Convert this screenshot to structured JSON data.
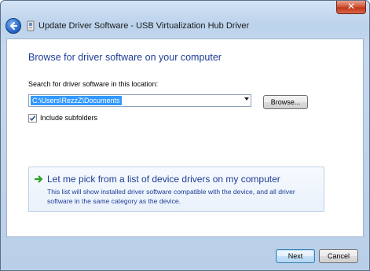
{
  "window": {
    "title": "Update Driver Software - USB Virtualization Hub Driver",
    "close_label": "✕"
  },
  "page": {
    "heading": "Browse for driver software on your computer",
    "search_label": "Search for driver software in this location:",
    "path_value": "C:\\Users\\RezzZ\\Documents",
    "browse_label": "Browse...",
    "include_subfolders_label": "Include subfolders",
    "include_subfolders_checked": true
  },
  "option": {
    "title": "Let me pick from a list of device drivers on my computer",
    "description": "This list will show installed driver software compatible with the device, and all driver software in the same category as the device."
  },
  "buttons": {
    "next_label": "Next",
    "cancel_label": "Cancel"
  },
  "colors": {
    "accent_text": "#1e3c96",
    "selection": "#3399ff",
    "close_red": "#c0391b",
    "arrow_green": "#2aa12a"
  },
  "icons": {
    "back": "back-arrow-icon",
    "title": "device-icon",
    "option": "green-arrow-icon",
    "combo": "chevron-down-icon",
    "check": "checkmark-icon"
  }
}
